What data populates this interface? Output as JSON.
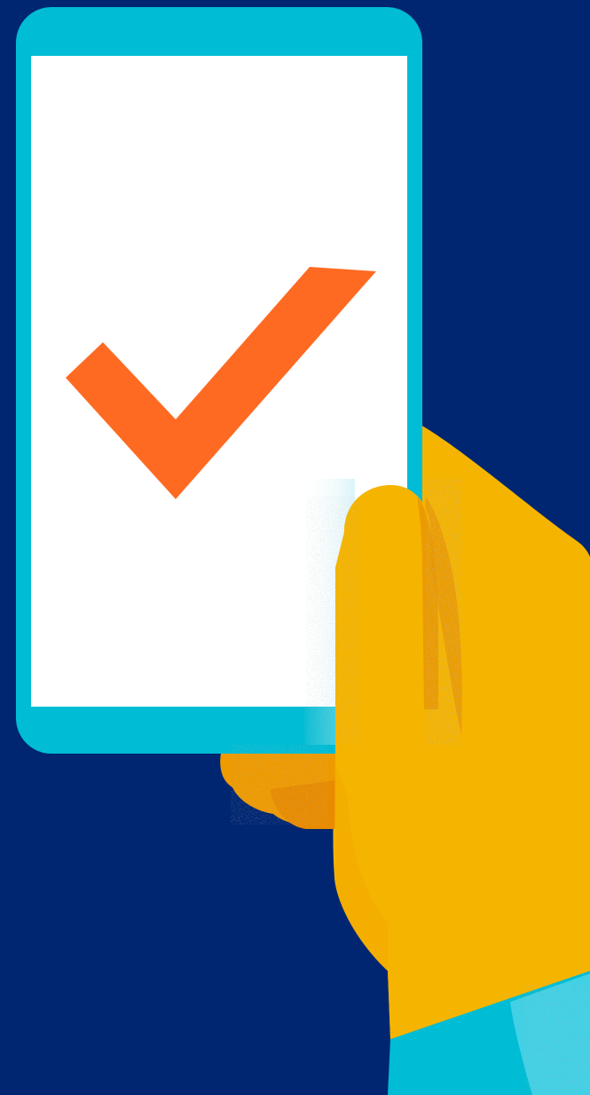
{
  "illustration": {
    "subject": "hand-holding-phone-checkmark",
    "icons": [
      "phone-icon",
      "checkmark-icon",
      "hand-icon"
    ]
  },
  "colors": {
    "background": "#002672",
    "phone_frame": "#00BCD4",
    "screen": "#FFFFFF",
    "checkmark": "#FF6A22",
    "hand": "#F5B400",
    "hand_shadow": "#EE9A00",
    "sleeve": "#00BCD4",
    "sleeve_highlight": "#5ED8EC"
  }
}
